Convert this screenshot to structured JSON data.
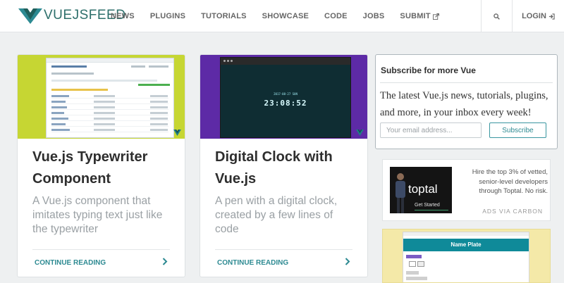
{
  "brand": {
    "logo_text": "VUEJSFEED",
    "accent": "#2d8a92",
    "logo_color": "#2d6f6b"
  },
  "nav": {
    "links": [
      {
        "label": "NEWS"
      },
      {
        "label": "PLUGINS"
      },
      {
        "label": "TUTORIALS"
      },
      {
        "label": "SHOWCASE"
      },
      {
        "label": "CODE"
      },
      {
        "label": "JOBS"
      },
      {
        "label": "SUBMIT",
        "icon": "external-link-icon"
      }
    ],
    "search_icon": "search-icon",
    "login_label": "LOGIN",
    "login_icon": "login-arrow-icon"
  },
  "cards": [
    {
      "title": "Vue.js Typewriter Component",
      "description": "A Vue.js component that imitates typing text just like the typewriter",
      "more_label": "CONTINUE READING",
      "arrow_icon": "chevron-right-icon",
      "thumb_color": "#c6d633"
    },
    {
      "title": "Digital Clock with Vue.js",
      "description": "A pen with a digital clock, created by a few lines of code",
      "more_label": "CONTINUE READING",
      "arrow_icon": "chevron-right-icon",
      "thumb_color": "#5d2aa6",
      "clock_date": "2017-08-27 SUN",
      "clock_time": "23:08:52"
    }
  ],
  "subscribe": {
    "title": "Subscribe for more Vue",
    "text": "The latest Vue.js news, tutorials, plugins, and more, in your inbox every week!",
    "email_placeholder": "Your email address...",
    "email_value": "",
    "button_label": "Subscribe"
  },
  "ad": {
    "brand": "toptal",
    "cta": "Get Started",
    "text": "Hire the top 3% of vetted, senior-level developers through Toptal. No risk.",
    "via_label": "ADS VIA CARBON"
  },
  "preview": {
    "header": "Name Plate",
    "bg_color": "#f4e9a8"
  }
}
